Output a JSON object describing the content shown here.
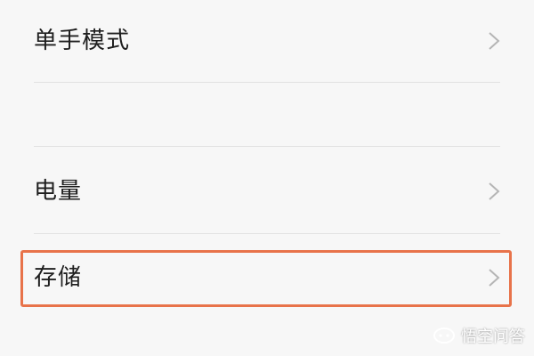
{
  "settings": {
    "items": [
      {
        "label": "单手模式"
      },
      {
        "label": "电量"
      },
      {
        "label": "存储"
      }
    ]
  },
  "colors": {
    "background": "#f7f7f7",
    "divider": "#e2e2e2",
    "highlight": "#e8734a",
    "chevron": "#b5b5b5"
  },
  "watermark": {
    "text": "悟空问答",
    "icon": "logo-icon"
  }
}
